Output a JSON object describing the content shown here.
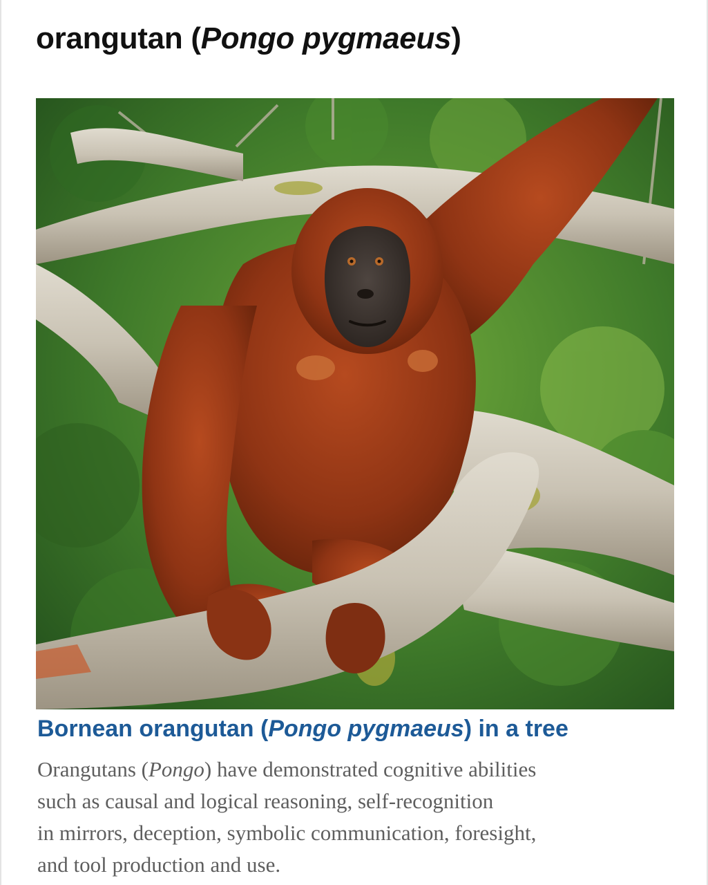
{
  "page": {
    "title": {
      "prefix": "orangutan (",
      "italic": "Pongo pygmaeus",
      "suffix": ")"
    }
  },
  "figure": {
    "image_subject": "orangutan",
    "caption": {
      "prefix": "Bornean orangutan (",
      "italic": "Pongo pygmaeus",
      "suffix": ") in a tree"
    }
  },
  "description": {
    "line1_prefix": "Orangutans (",
    "line1_italic": "Pongo",
    "line1_suffix": ") have demonstrated cognitive abilities",
    "line2": "such as causal and logical reasoning, self-recognition",
    "line3": "in mirrors, deception, symbolic communication, foresight,",
    "line4": "and tool production and use."
  },
  "colors": {
    "title": "#111111",
    "caption": "#1d5a97",
    "body": "#5e5e5e",
    "fur": "#9a3a17",
    "foliage": "#3f7a2a",
    "bark": "#c9c2b3"
  }
}
